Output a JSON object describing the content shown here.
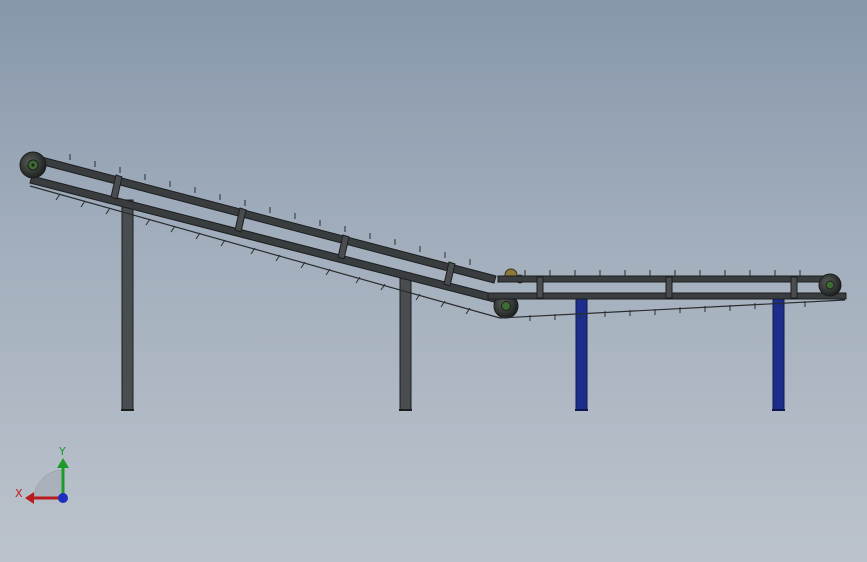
{
  "viewport": {
    "background_top": "#8797ab",
    "background_bottom": "#bcc3cc"
  },
  "model": {
    "frame_color": "#3a3d40",
    "frame_edge_color": "#1c1d1e",
    "leg_color_inclined": "#4a4d50",
    "leg_color_horizontal": "#1c2d8c",
    "roller_color": "#2e3230",
    "roller_hub_color": "#3e6b33",
    "idler_color": "#8a7a3a"
  },
  "triad": {
    "x_label": "X",
    "y_label": "Y",
    "x_color": "#b81c1c",
    "y_color": "#1c9a2a",
    "z_color": "#1c2fc0"
  }
}
